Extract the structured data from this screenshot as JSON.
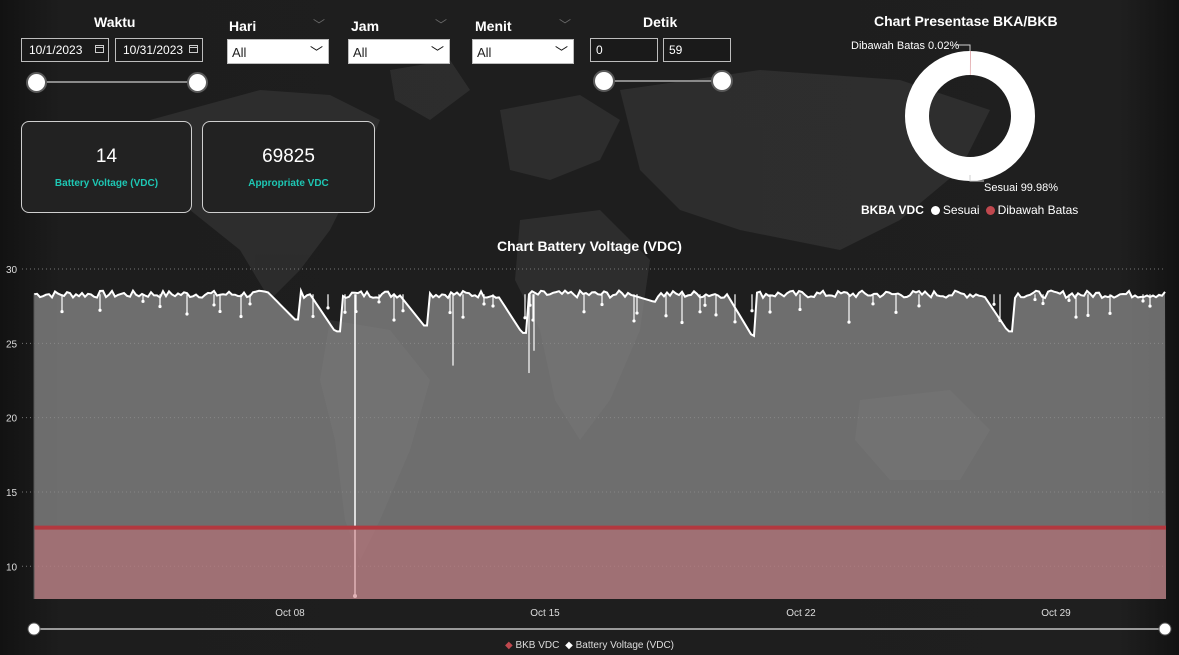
{
  "filters": {
    "waktu": {
      "label": "Waktu",
      "start": "10/1/2023",
      "end": "10/31/2023"
    },
    "hari": {
      "label": "Hari",
      "value": "All"
    },
    "jam": {
      "label": "Jam",
      "value": "All"
    },
    "menit": {
      "label": "Menit",
      "value": "All"
    },
    "detik": {
      "label": "Detik",
      "min": "0",
      "max": "59"
    }
  },
  "cards": [
    {
      "value": "14",
      "label": "Battery Voltage (VDC)"
    },
    {
      "value": "69825",
      "label": "Appropriate VDC"
    }
  ],
  "donut": {
    "title": "Chart Presentase BKA/BKB",
    "label_below": "Dibawah Batas 0.02%",
    "label_ok": "Sesuai 99.98%",
    "legend_title": "BKBA VDC",
    "legend_items": [
      {
        "name": "Sesuai",
        "color": "#ffffff"
      },
      {
        "name": "Dibawah Batas",
        "color": "#c0484e"
      }
    ]
  },
  "chart_data": {
    "type": "area",
    "title": "Chart Battery Voltage (VDC)",
    "y_ticks": [
      "30",
      "25",
      "20",
      "15",
      "10"
    ],
    "x_ticks": [
      "Oct 08",
      "Oct 15",
      "Oct 22",
      "Oct 29"
    ],
    "ylim": [
      7.8,
      30
    ],
    "grid": true,
    "series": [
      {
        "name": "BKB VDC",
        "color": "#b3383f",
        "value": 12.6
      },
      {
        "name": "Battery Voltage (VDC)",
        "color": "#ffffff",
        "typical": 28.3,
        "min_dip": 8
      }
    ],
    "legend_items": [
      {
        "marker": "◆",
        "name": "BKB VDC",
        "color": "#c0484e"
      },
      {
        "marker": "◆",
        "name": "Battery Voltage (VDC)",
        "color": "#ffffff"
      }
    ]
  },
  "colors": {
    "accent": "#1ec7b4",
    "threshold": "#b3383f"
  }
}
